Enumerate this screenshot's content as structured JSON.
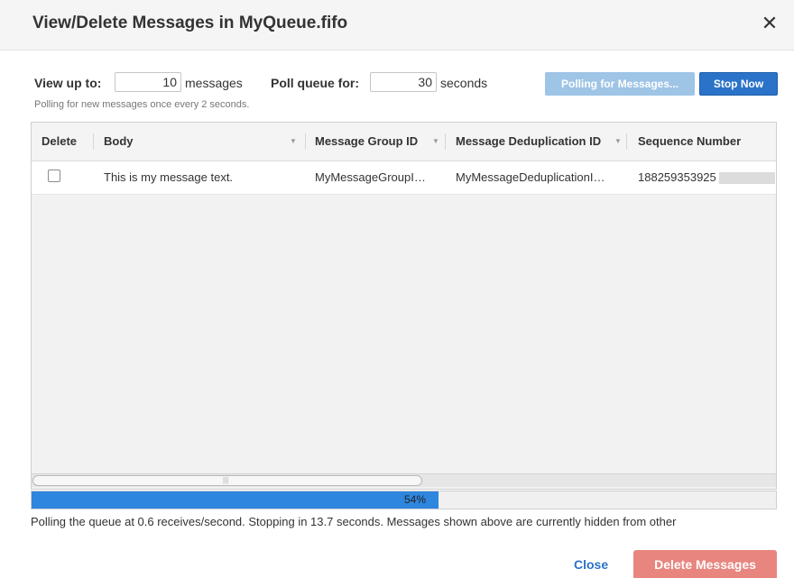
{
  "dialog": {
    "title": "View/Delete Messages in MyQueue.fifo",
    "close_glyph": "✕"
  },
  "controls": {
    "view_up_to_label": "View up to:",
    "view_up_to_value": "10",
    "messages_text": "messages",
    "poll_label": "Poll queue for:",
    "poll_value": "30",
    "seconds_text": "seconds",
    "polling_hint": "Polling for new messages once every 2 seconds.",
    "polling_button_label": "Polling for Messages...",
    "stop_button_label": "Stop Now"
  },
  "table": {
    "columns": [
      "Delete",
      "Body",
      "Message Group ID",
      "Message Deduplication ID",
      "Sequence Number"
    ],
    "rows": [
      {
        "checked": false,
        "body": "This is my message text.",
        "group_id": "MyMessageGroupI…",
        "dedup_id": "MyMessageDeduplicationI…",
        "sequence": "188259353925"
      }
    ],
    "scroll_grip": "|||"
  },
  "progress": {
    "percent": 54,
    "label": "54%"
  },
  "status_text": "Polling the queue at 0.6 receives/second. Stopping in 13.7 seconds. Messages shown above are currently hidden from other",
  "footer": {
    "close_label": "Close",
    "delete_label": "Delete Messages"
  },
  "colors": {
    "primary": "#2b73c9",
    "primary_disabled": "#9ec4e6",
    "danger_disabled": "#e8857f",
    "progress": "#2e86de"
  },
  "icons": {
    "close": "close-icon",
    "sort": "sort-caret-icon"
  }
}
